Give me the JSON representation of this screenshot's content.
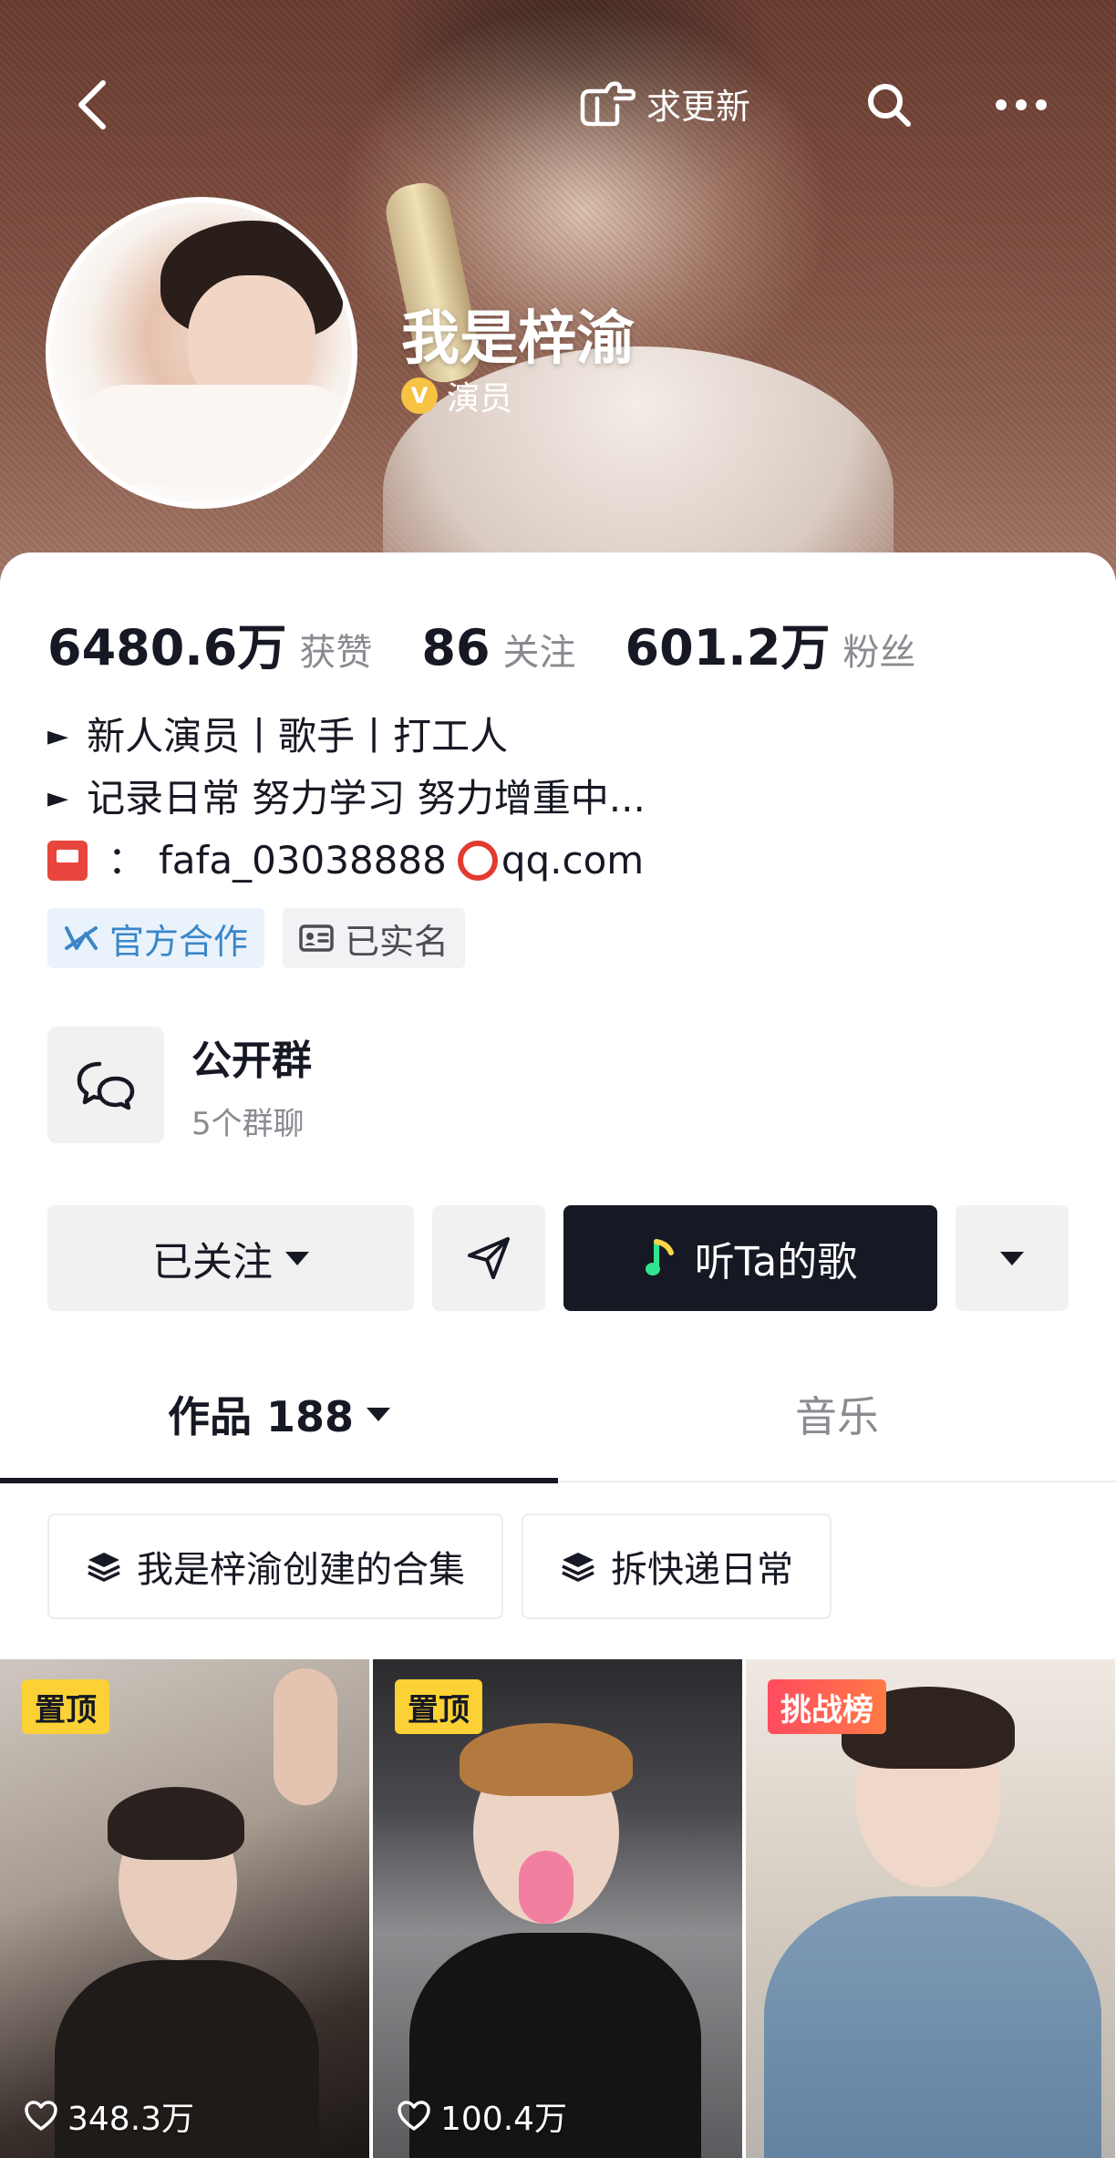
{
  "header": {
    "request_update_label": "求更新",
    "back_icon": "chevron-left-icon",
    "search_icon": "search-icon",
    "more_icon": "more-icon"
  },
  "profile": {
    "name": "我是梓渝",
    "verification": "演员",
    "verification_badge": "V",
    "stats": [
      {
        "value": "6480.6万",
        "label": "获赞"
      },
      {
        "value": "86",
        "label": "关注"
      },
      {
        "value": "601.2万",
        "label": "粉丝"
      }
    ],
    "bio": {
      "line1_prefix": "►",
      "line1": "新人演员丨歌手丨打工人",
      "line2_prefix": "►",
      "line2": "记录日常 努力学习 努力增重中...",
      "contact_handle": "fafa_03038888",
      "contact_domain": "qq.com"
    },
    "tags": {
      "official": "官方合作",
      "realname": "已实名"
    }
  },
  "group": {
    "title": "公开群",
    "subtitle": "5个群聊"
  },
  "actions": {
    "follow_label": "已关注",
    "song_label": "听Ta的歌"
  },
  "tabs": {
    "works_label": "作品 188",
    "music_label": "音乐"
  },
  "collections": [
    {
      "label": "我是梓渝创建的合集"
    },
    {
      "label": "拆快递日常"
    }
  ],
  "videos": [
    {
      "badge": "置顶",
      "likes": "348.3万"
    },
    {
      "badge": "置顶",
      "likes": "100.4万"
    },
    {
      "badge": "挑战榜",
      "likes": ""
    }
  ],
  "colors": {
    "primary_text": "#161823",
    "secondary_text": "#8a8b91",
    "pin_badge": "#fbd135",
    "official_tag": "#3b86c8",
    "song_button": "#161823"
  }
}
